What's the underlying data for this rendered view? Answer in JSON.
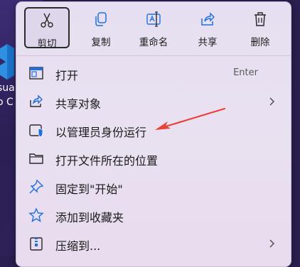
{
  "desktop": {
    "line1": "sua",
    "line2": "o C"
  },
  "toolbar": {
    "cut": "剪切",
    "copy": "复制",
    "rename": "重命名",
    "share": "共享",
    "delete": "删除"
  },
  "menu": {
    "open": "打开",
    "open_shortcut": "Enter",
    "share_with": "共享对象",
    "run_as_admin": "以管理员身份运行",
    "open_location": "打开文件所在的位置",
    "pin_start": "固定到\"开始\"",
    "add_favorites": "添加到收藏夹",
    "compress": "压缩到..."
  },
  "colors": {
    "accent": "#1e6fe0",
    "annotation_arrow": "#e8413a"
  },
  "icons": {
    "cut": "scissors-icon",
    "copy": "copy-icon",
    "rename": "rename-icon",
    "share": "share-icon",
    "delete": "trash-icon"
  }
}
